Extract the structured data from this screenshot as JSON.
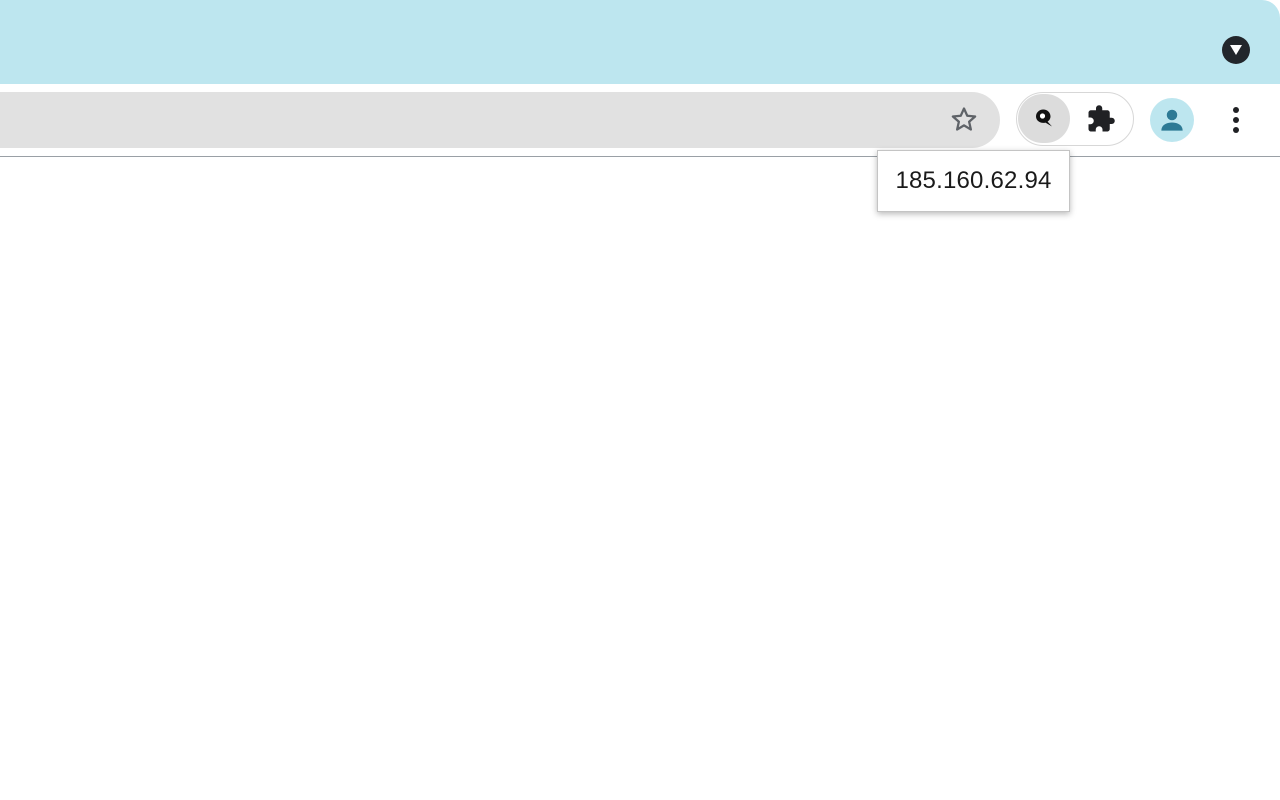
{
  "browser": {
    "title_bar": {
      "background_color": "#bde6ef",
      "tab_search_icon": "chevron-down-icon"
    },
    "toolbar": {
      "omnibox": {
        "value": "",
        "bookmark_icon": "star-outline-icon"
      },
      "extensions": {
        "pinned_extension_icon": "location-pin-icon",
        "extensions_menu_icon": "puzzle-piece-icon"
      },
      "profile": {
        "avatar_icon": "person-icon",
        "avatar_color": "#bde6ef"
      },
      "menu_icon": "three-dots-vertical-icon"
    },
    "tooltip": {
      "text": "185.160.62.94"
    }
  }
}
